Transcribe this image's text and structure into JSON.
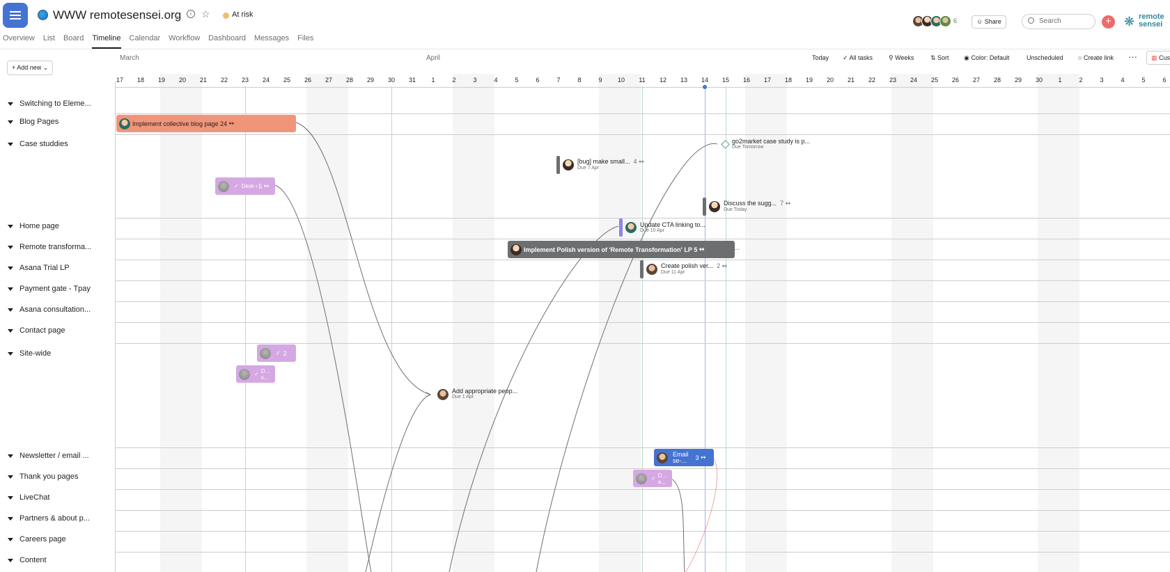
{
  "header": {
    "title": "WWW remotesensei.org",
    "status": "At risk",
    "member_count": "6",
    "share_label": "Share",
    "search_placeholder": "Search",
    "logo_text_1": "remote",
    "logo_text_2": "sensei",
    "colors": {
      "accent": "#4573d2",
      "status": "#f1bd6c",
      "add": "#f06a6a",
      "brand": "#2f8a9e"
    }
  },
  "tabs": [
    "Overview",
    "List",
    "Board",
    "Timeline",
    "Calendar",
    "Workflow",
    "Dashboard",
    "Messages",
    "Files"
  ],
  "active_tab": "Timeline",
  "toolbar": {
    "add_new": "Add new",
    "months": [
      "March",
      "April"
    ],
    "today": "Today",
    "all_tasks": "All tasks",
    "weeks": "Weeks",
    "sort": "Sort",
    "color": "Color: Default",
    "unscheduled": "Unscheduled",
    "create_link": "Create link",
    "more": "···",
    "customize": "Cus"
  },
  "days": [
    "17",
    "18",
    "19",
    "20",
    "21",
    "22",
    "23",
    "24",
    "25",
    "26",
    "27",
    "28",
    "29",
    "30",
    "31",
    "1",
    "2",
    "3",
    "4",
    "5",
    "6",
    "7",
    "8",
    "9",
    "10",
    "11",
    "12",
    "13",
    "14",
    "15",
    "16",
    "17",
    "18",
    "19",
    "20",
    "21",
    "22",
    "23",
    "24",
    "25",
    "26",
    "27",
    "28",
    "29",
    "30",
    "1",
    "2",
    "3",
    "4",
    "5",
    "6"
  ],
  "sections": [
    "Switching to Eleme...",
    "Blog Pages",
    "Case studdies",
    "Home page",
    "Remote transforma...",
    "Asana Trial LP",
    "Payment gate - Tpay",
    "Asana consultation...",
    "Contact page",
    "Site-wide",
    "Newsletter / email ...",
    "Thank you pages",
    "LiveChat",
    "Partners & about p...",
    "Careers page",
    "Content"
  ],
  "tasks": {
    "blog": {
      "label": "Implement collective blog page",
      "count": "24"
    },
    "case_desk": {
      "label": "Desk col...",
      "count": "5"
    },
    "bug": {
      "label": "[bug] make small...",
      "count": "4",
      "due": "Due 7 Apr"
    },
    "go2market": {
      "label": "go2market case study is p...",
      "due": "Due Tomorrow"
    },
    "discuss": {
      "label": "Discuss the sugg...",
      "count": "7",
      "due": "Due Today"
    },
    "cta": {
      "label": "Update CTA linking to...",
      "due": "Due 10 Apr"
    },
    "polish": {
      "label": "Implement Polish version of 'Remote Transformation' LP",
      "count": "5"
    },
    "create_polish": {
      "label": "Create polish ver...",
      "count": "2",
      "due": "Due 11 Apr"
    },
    "site_a": {
      "count": "2"
    },
    "site_b": {
      "label": "D... s..."
    },
    "add_people": {
      "label": "Add appropriate peop...",
      "due": "Due 1 Apr"
    },
    "email": {
      "label": "Email se-...",
      "count": "3"
    },
    "thank": {
      "label": "D... a..."
    }
  }
}
